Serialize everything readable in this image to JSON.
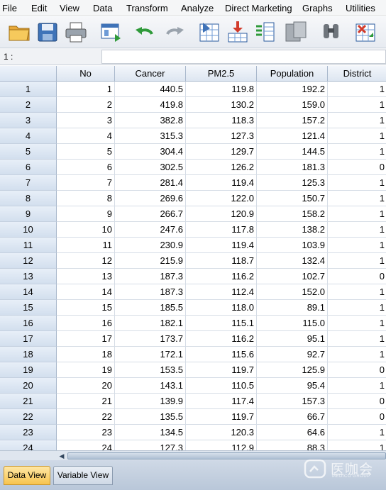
{
  "menu": [
    "File",
    "Edit",
    "View",
    "Data",
    "Transform",
    "Analyze",
    "Direct Marketing",
    "Graphs",
    "Utilities"
  ],
  "toolbar": {
    "buttons": [
      "open-folder-icon",
      "save-icon",
      "print-icon",
      "dialog-recall-icon",
      "undo-icon",
      "redo-icon",
      "goto-case-icon",
      "goto-variable-icon",
      "variables-icon",
      "run-descriptive-icon",
      "find-icon",
      "insert-cases-icon"
    ]
  },
  "editor": {
    "cell_ref": "1 :",
    "cell_value": ""
  },
  "grid": {
    "columns": [
      "No",
      "Cancer",
      "PM2.5",
      "Population",
      "District"
    ],
    "rows": [
      {
        "num": "1",
        "cells": [
          "1",
          "440.5",
          "119.8",
          "192.2",
          "1"
        ]
      },
      {
        "num": "2",
        "cells": [
          "2",
          "419.8",
          "130.2",
          "159.0",
          "1"
        ]
      },
      {
        "num": "3",
        "cells": [
          "3",
          "382.8",
          "118.3",
          "157.2",
          "1"
        ]
      },
      {
        "num": "4",
        "cells": [
          "4",
          "315.3",
          "127.3",
          "121.4",
          "1"
        ]
      },
      {
        "num": "5",
        "cells": [
          "5",
          "304.4",
          "129.7",
          "144.5",
          "1"
        ]
      },
      {
        "num": "6",
        "cells": [
          "6",
          "302.5",
          "126.2",
          "181.3",
          "0"
        ]
      },
      {
        "num": "7",
        "cells": [
          "7",
          "281.4",
          "119.4",
          "125.3",
          "1"
        ]
      },
      {
        "num": "8",
        "cells": [
          "8",
          "269.6",
          "122.0",
          "150.7",
          "1"
        ]
      },
      {
        "num": "9",
        "cells": [
          "9",
          "266.7",
          "120.9",
          "158.2",
          "1"
        ]
      },
      {
        "num": "10",
        "cells": [
          "10",
          "247.6",
          "117.8",
          "138.2",
          "1"
        ]
      },
      {
        "num": "11",
        "cells": [
          "11",
          "230.9",
          "119.4",
          "103.9",
          "1"
        ]
      },
      {
        "num": "12",
        "cells": [
          "12",
          "215.9",
          "118.7",
          "132.4",
          "1"
        ]
      },
      {
        "num": "13",
        "cells": [
          "13",
          "187.3",
          "116.2",
          "102.7",
          "0"
        ]
      },
      {
        "num": "14",
        "cells": [
          "14",
          "187.3",
          "112.4",
          "152.0",
          "1"
        ]
      },
      {
        "num": "15",
        "cells": [
          "15",
          "185.5",
          "118.0",
          "89.1",
          "1"
        ]
      },
      {
        "num": "16",
        "cells": [
          "16",
          "182.1",
          "115.1",
          "115.0",
          "1"
        ]
      },
      {
        "num": "17",
        "cells": [
          "17",
          "173.7",
          "116.2",
          "95.1",
          "1"
        ]
      },
      {
        "num": "18",
        "cells": [
          "18",
          "172.1",
          "115.6",
          "92.7",
          "1"
        ]
      },
      {
        "num": "19",
        "cells": [
          "19",
          "153.5",
          "119.7",
          "125.9",
          "0"
        ]
      },
      {
        "num": "20",
        "cells": [
          "20",
          "143.1",
          "110.5",
          "95.4",
          "1"
        ]
      },
      {
        "num": "21",
        "cells": [
          "21",
          "139.9",
          "117.4",
          "157.3",
          "0"
        ]
      },
      {
        "num": "22",
        "cells": [
          "22",
          "135.5",
          "119.7",
          "66.7",
          "0"
        ]
      },
      {
        "num": "23",
        "cells": [
          "23",
          "134.5",
          "120.3",
          "64.6",
          "1"
        ]
      },
      {
        "num": "24",
        "cells": [
          "24",
          "127.3",
          "112.9",
          "88.3",
          "1"
        ]
      }
    ]
  },
  "tabs": {
    "data_view": "Data View",
    "variable_view": "Variable View"
  },
  "watermark": {
    "text": "医咖会",
    "sub": "MEDICO GROUP",
    "logo": "medico-logo-icon"
  },
  "colors": {
    "active_tab": "#f7c44e",
    "header_blue": "#d9e4f2"
  }
}
